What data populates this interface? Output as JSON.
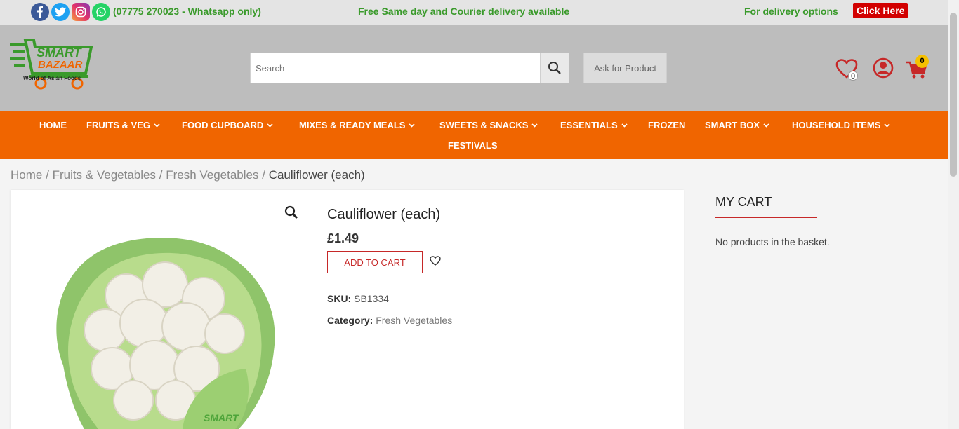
{
  "topbar": {
    "phone": "(07775 270023 - Whatsapp only)",
    "delivery_message": "Free Same day and Courier delivery available",
    "delivery_options": "For delivery options",
    "click_here": "Click Here"
  },
  "header": {
    "logo_line1": "SMART",
    "logo_line2": "BAZAAR",
    "logo_tagline": "World of Asian Foods",
    "search_placeholder": "Search",
    "ask_product": "Ask for Product",
    "wishlist_count": "0",
    "cart_count": "0"
  },
  "nav": {
    "items": [
      {
        "label": "HOME",
        "dropdown": false
      },
      {
        "label": "FRUITS & VEG",
        "dropdown": true
      },
      {
        "label": "FOOD CUPBOARD",
        "dropdown": true
      },
      {
        "label": "MIXES & READY MEALS",
        "dropdown": true
      },
      {
        "label": "SWEETS & SNACKS",
        "dropdown": true
      },
      {
        "label": "ESSENTIALS",
        "dropdown": true
      },
      {
        "label": "FROZEN",
        "dropdown": false
      },
      {
        "label": "SMART BOX",
        "dropdown": true
      },
      {
        "label": "HOUSEHOLD ITEMS",
        "dropdown": true
      },
      {
        "label": "FESTIVALS",
        "dropdown": false
      }
    ]
  },
  "breadcrumb": {
    "home": "Home",
    "cat1": "Fruits & Vegetables",
    "cat2": "Fresh Vegetables",
    "current": "Cauliflower (each)",
    "separator": "/"
  },
  "product": {
    "title": "Cauliflower (each)",
    "price": "£1.49",
    "add_to_cart": "ADD TO CART",
    "sku_label": "SKU:",
    "sku_value": "SB1334",
    "category_label": "Category:",
    "category_value": "Fresh Vegetables"
  },
  "sidebar": {
    "title": "MY CART",
    "empty_message": "No products in the basket."
  },
  "colors": {
    "nav_orange": "#f06500",
    "brand_green": "#3a9a2b",
    "accent_red": "#c62828",
    "badge_yellow": "#f5c000"
  }
}
